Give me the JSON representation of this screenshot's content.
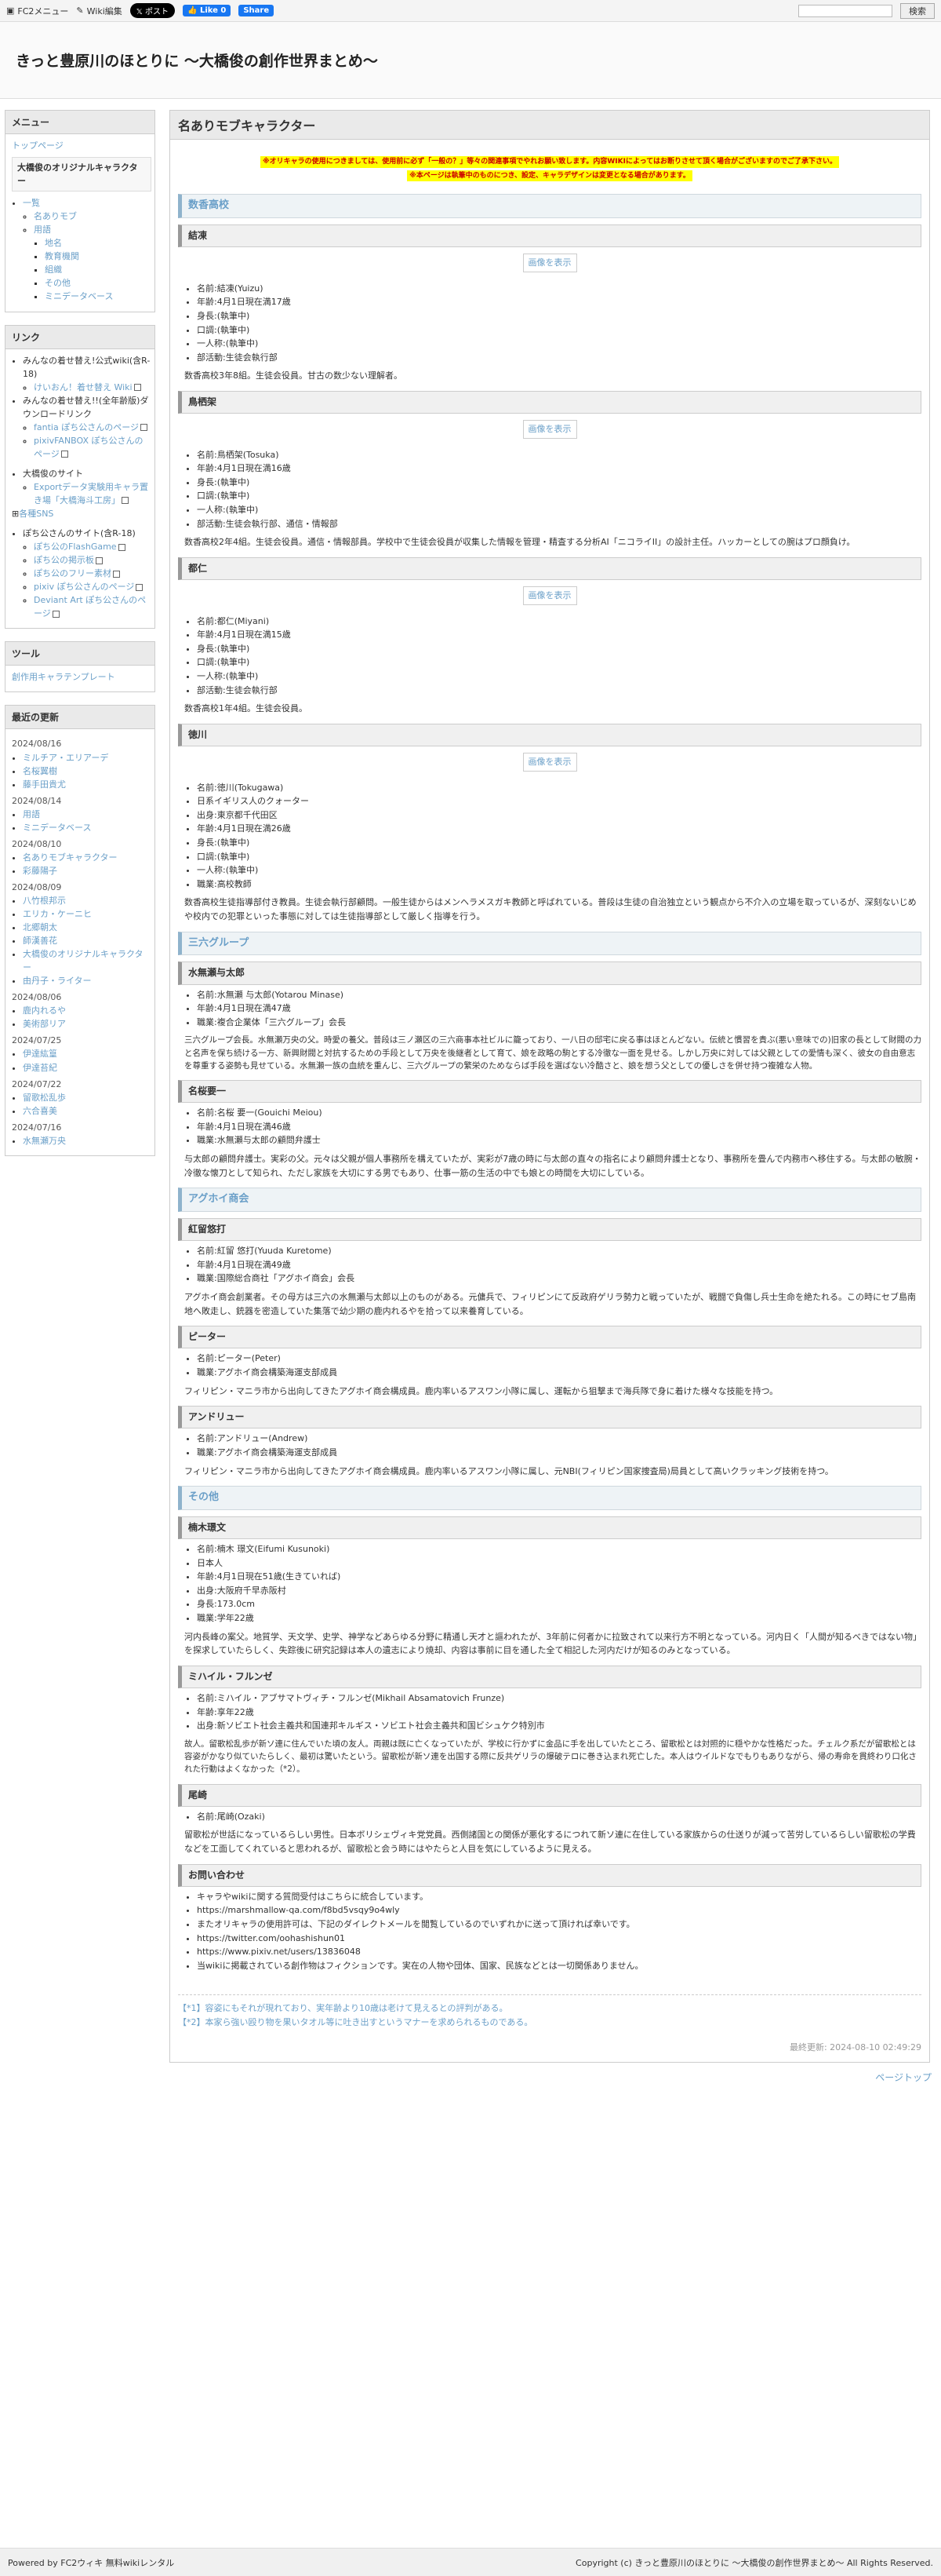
{
  "topbar": {
    "fc2_menu": "FC2メニュー",
    "wiki_edit": "Wiki編集",
    "x_post": "ポスト",
    "fb_like": "Like 0",
    "fb_share": "Share",
    "search_button": "検索"
  },
  "site_title": "きっと豊原川のほとりに 〜大橋俊の創作世界まとめ〜",
  "sidebar": {
    "menu": {
      "title": "メニュー",
      "top_link": "トップページ",
      "card": "大橋俊のオリジナルキャラクター",
      "items": [
        "一覧",
        "名ありモブ",
        "用語",
        "地名",
        "教育機関",
        "組織",
        "その他",
        "ミニデータベース"
      ]
    },
    "links": {
      "title": "リンク",
      "items": [
        "みんなの着せ替え!公式wiki(含R-18)",
        "けいおん！着せ替え Wiki",
        "みんなの着せ替え!!(全年齢版)ダウンロードリンク",
        "fantia ぽち公さんのページ",
        "pixivFANBOX ぽち公さんのページ",
        "大橋俊のサイト",
        "Exportデータ実験用キャラ置き場「大橋海斗工房」",
        "各種SNS",
        "ぽち公さんのサイト(含R-18)",
        "ぽち公のFlashGame",
        "ぽち公の掲示板",
        "ぽち公のフリー素材",
        "pixiv ぽち公さんのページ",
        "Deviant Art ぽち公さんのページ"
      ]
    },
    "tools": {
      "title": "ツール",
      "item": "創作用キャラテンプレート"
    },
    "updates": {
      "title": "最近の更新",
      "groups": [
        {
          "date": "2024/08/16",
          "items": [
            "ミルチア・エリアーデ",
            "名桜翼樹",
            "藤手田貴尤"
          ]
        },
        {
          "date": "2024/08/14",
          "items": [
            "用語",
            "ミニデータベース"
          ]
        },
        {
          "date": "2024/08/10",
          "items": [
            "名ありモブキャラクター",
            "彩藤陽子"
          ]
        },
        {
          "date": "2024/08/09",
          "items": [
            "八竹根邦示",
            "エリカ・ケーニヒ",
            "北郷朝太",
            "師漢善花",
            "大橋俊のオリジナルキャラクター",
            "由丹子・ライター"
          ]
        },
        {
          "date": "2024/08/06",
          "items": [
            "鹿内れるや",
            "美術部リア"
          ]
        },
        {
          "date": "2024/07/25",
          "items": [
            "伊達紘篁",
            "伊達苔紀"
          ]
        },
        {
          "date": "2024/07/22",
          "items": [
            "留歌松乱歩",
            "六合喜美"
          ]
        },
        {
          "date": "2024/07/16",
          "items": [
            "水無瀬万央"
          ]
        }
      ]
    }
  },
  "main": {
    "title": "名ありモブキャラクター",
    "notice_1": "※オリキャラの使用につきましては、使用前に必ず「一般の？」等々の関連事項でやれお願い致します。内容WIKIによってはお断りさせて頂く場合がございますのでご了承下さい。",
    "notice_2": "※本ページは執筆中のものにつき、設定、キャラデザインは変更となる場合があります。",
    "img_label": "画像を表示",
    "sections": [
      {
        "group": "数香高校",
        "chars": [
          {
            "name": "結凍",
            "has_img": true,
            "info": [
              "名前:結凍(Yuizu)",
              "年齢:4月1日現在満17歳",
              "身長:(執筆中)",
              "口調:(執筆中)",
              "一人称:(執筆中)",
              "部活動:生徒会執行部"
            ],
            "desc": "数香高校3年8組。生徒会役員。甘古の数少ない理解者。"
          },
          {
            "name": "鳥栖架",
            "has_img": true,
            "info": [
              "名前:鳥栖架(Tosuka)",
              "年齢:4月1日現在満16歳",
              "身長:(執筆中)",
              "口調:(執筆中)",
              "一人称:(執筆中)",
              "部活動:生徒会執行部、通信・情報部"
            ],
            "desc": "数香高校2年4組。生徒会役員。通信・情報部員。学校中で生徒会役員が収集した情報を管理・精査する分析AI「ニコライII」の設計主任。ハッカーとしての腕はプロ顔負け。"
          },
          {
            "name": "都仁",
            "has_img": true,
            "info": [
              "名前:都仁(Miyani)",
              "年齢:4月1日現在満15歳",
              "身長:(執筆中)",
              "口調:(執筆中)",
              "一人称:(執筆中)",
              "部活動:生徒会執行部"
            ],
            "desc": "数香高校1年4組。生徒会役員。"
          },
          {
            "name": "徳川",
            "has_img": true,
            "info": [
              "名前:徳川(Tokugawa)",
              "日系イギリス人のクォーター",
              "出身:東京都千代田区",
              "年齢:4月1日現在満26歳",
              "身長:(執筆中)",
              "口調:(執筆中)",
              "一人称:(執筆中)",
              "職業:高校教師"
            ],
            "desc": "数香高校生徒指導部付き教員。生徒会執行部顧問。一般生徒からはメンヘラメスガキ教師と呼ばれている。普段は生徒の自治独立という観点から不介入の立場を取っているが、深刻ないじめや校内での犯罪といった事態に対しては生徒指導部として厳しく指導を行う。"
          }
        ]
      },
      {
        "group": "三六グループ",
        "chars": [
          {
            "name": "水無瀬与太郎",
            "has_img": false,
            "info": [
              "名前:水無瀬 与太郎(Yotarou Minase)",
              "年齢:4月1日現在満47歳",
              "職業:複合企業体「三六グループ」会長"
            ],
            "desc": "三六グループ会長。水無瀬万央の父。時愛の養父。普段は三ノ瀬区の三六商事本社ビルに籠っており、一八日の邸宅に戻る事はほとんどない。伝統と慣習を貴ぶ(悪い意味での)旧家の長として財閥の力と名声を保ち続ける一方、新興財閥と対抗するための手段として万央を後継者として育て、娘を政略の駒とする冷徹な一面を見せる。しかし万央に対しては父親としての愛情も深く、彼女の自由意志を尊重する姿勢も見せている。水無瀬一族の血統を重んじ、三六グループの繁栄のためならば手段を選ばない冷酷さと、娘を想う父としての優しさを併せ持つ複雑な人物。"
          },
          {
            "name": "名桜要一",
            "has_img": false,
            "info": [
              "名前:名桜 要一(Gouichi Meiou)",
              "年齢:4月1日現在満46歳",
              "職業:水無瀬与太郎の顧問弁護士"
            ],
            "desc": "与太郎の顧問弁護士。実彩の父。元々は父親が個人事務所を構えていたが、実彩が7歳の時に与太郎の直々の指名により顧問弁護士となり、事務所を畳んで内務市へ移住する。与太郎の敏腕・冷徹な懐刀として知られ、ただし家族を大切にする男でもあり、仕事一筋の生活の中でも娘との時間を大切にしている。"
          }
        ]
      },
      {
        "group": "アグホイ商会",
        "chars": [
          {
            "name": "紅留悠打",
            "has_img": false,
            "info": [
              "名前:紅留 悠打(Yuuda Kuretome)",
              "年齢:4月1日現在満49歳",
              "職業:国際総合商社「アグホイ商会」会長"
            ],
            "desc": "アグホイ商会創業者。その母方は三六の水無瀬与太郎以上のものがある。元傭兵で、フィリピンにて反政府ゲリラ勢力と戦っていたが、戦闘で負傷し兵士生命を絶たれる。この時にセブ島南地へ敗走し、銃器を密造していた集落で幼少期の鹿内れるやを拾って以来養育している。"
          },
          {
            "name": "ピーター",
            "has_img": false,
            "info": [
              "名前:ピーター(Peter)",
              "職業:アグホイ商会構築海運支部成員"
            ],
            "desc": "フィリピン・マニラ市から出向してきたアグホイ商会構成員。鹿内率いるアスワン小隊に属し、運転から狙撃まで海兵隊で身に着けた様々な技能を持つ。"
          },
          {
            "name": "アンドリュー",
            "has_img": false,
            "info": [
              "名前:アンドリュー(Andrew)",
              "職業:アグホイ商会構築海運支部成員"
            ],
            "desc": "フィリピン・マニラ市から出向してきたアグホイ商会構成員。鹿内率いるアスワン小隊に属し、元NBI(フィリピン国家捜査局)局員として高いクラッキング技術を持つ。"
          }
        ]
      },
      {
        "group": "その他",
        "chars": [
          {
            "name": "楠木璟文",
            "has_img": false,
            "info": [
              "名前:楠木 璟文(Eifumi Kusunoki)",
              "日本人",
              "年齢:4月1日現在51歳(生きていれば)",
              "出身:大阪府千早赤阪村",
              "身長:173.0cm",
              "職業:学年22歳"
            ],
            "desc": "河内長峰の案父。地質学、天文学、史学、神学などあらゆる分野に精通し天才と謳われたが、3年前に何者かに拉致されて以来行方不明となっている。河内日く「人間が知るべきではない物」を探求していたらしく、失踪後に研究記録は本人の遺志により焼却、内容は事前に目を通した全て相記した河内だけが知るのみとなっている。"
          },
          {
            "name": "ミハイル・フルンゼ",
            "has_img": false,
            "info": [
              "名前:ミハイル・アブサマトヴィチ・フルンゼ(Mikhail Absamatovich Frunze)",
              "年齢:享年22歳",
              "出身:新ソビエト社会主義共和国連邦キルギス・ソビエト社会主義共和国ビシュケク特別市"
            ],
            "desc": "故人。留歌松乱歩が新ソ連に住んでいた頃の友人。両親は既に亡くなっていたが、学校に行かずに金品に手を出していたところ、留歌松とは対照的に穏やかな性格だった。チェルク系だが留歌松とは容姿がかなり似ていたらしく、最初は驚いたという。留歌松が新ソ連を出国する際に反共ゲリラの爆破テロに巻き込まれ死亡した。本人はウイルドなでもりもありながら、帰の寿命を貫終わり口化された行動はよくなかった（*2）。"
          },
          {
            "name": "尾崎",
            "has_img": false,
            "info": [
              "名前:尾崎(Ozaki)"
            ],
            "desc": "留歌松が世話になっているらしい男性。日本ボリシェヴィキ党党員。西側諸国との関係が悪化するにつれて新ソ連に在住している家族からの仕送りが減って苦労しているらしい留歌松の学費などを工面してくれていると思われるが、留歌松と会う時にはやたらと人目を気にしているように見える。"
          },
          {
            "name": "お問い合わせ",
            "has_img": false,
            "info": [
              "キャラやwikiに関する質問受付はこちらに統合しています。",
              "https://marshmallow-qa.com/f8bd5vsqy9o4wly",
              "またオリキャラの使用許可は、下記のダイレクトメールを閲覧しているのでいずれかに送って頂ければ幸いです。",
              "https://twitter.com/oohashishun01",
              "https://www.pixiv.net/users/13836048",
              "当wikiに掲載されている創作物はフィクションです。実在の人物や団体、国家、民族などとは一切関係ありません。"
            ],
            "desc": ""
          }
        ]
      }
    ],
    "footnotes": [
      "【*1】容姿にもそれが現れており、実年齢より10歳は老けて見えるとの評判がある。",
      "【*2】本家ら強い殴り物を果いタオル等に吐き出すというマナーを求められるものである。"
    ],
    "last_update": "最終更新: 2024-08-10 02:49:29"
  },
  "pagetop": "ページトップ",
  "footer": {
    "powered": "Powered by FC2ウィキ 無料wikiレンタル",
    "copyright": "Copyright (c) きっと豊原川のほとりに 〜大橋俊の創作世界まとめ〜 All Rights Reserved."
  }
}
